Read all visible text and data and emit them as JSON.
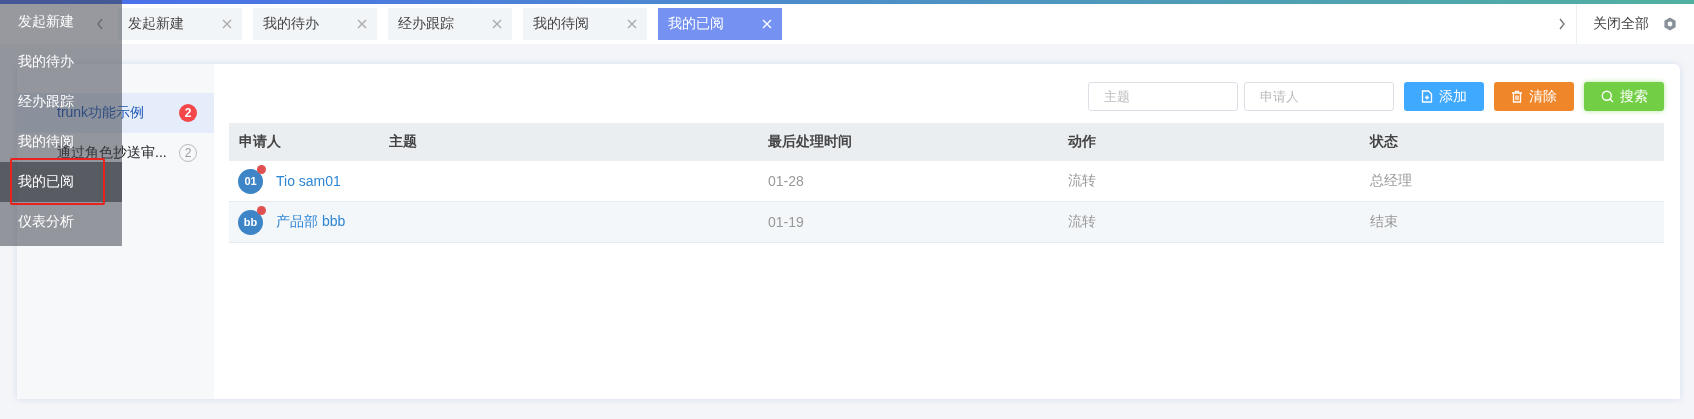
{
  "menu": {
    "items": [
      {
        "label": "发起新建",
        "selected": false
      },
      {
        "label": "我的待办",
        "selected": false
      },
      {
        "label": "经办跟踪",
        "selected": false
      },
      {
        "label": "我的待阅",
        "selected": false
      },
      {
        "label": "我的已阅",
        "selected": true
      },
      {
        "label": "仪表分析",
        "selected": false
      }
    ]
  },
  "tabs": {
    "items": [
      {
        "label": "发起新建",
        "selected": false
      },
      {
        "label": "我的待办",
        "selected": false
      },
      {
        "label": "经办跟踪",
        "selected": false
      },
      {
        "label": "我的待阅",
        "selected": false
      },
      {
        "label": "我的已阅",
        "selected": true
      }
    ],
    "close_all": "关闭全部"
  },
  "sidebar": {
    "items": [
      {
        "label": "trunk功能示例",
        "count": "2",
        "selected": true
      },
      {
        "label": "通过角色抄送审...",
        "count": "2",
        "selected": false
      }
    ]
  },
  "filters": {
    "fields": [
      {
        "placeholder": "主题"
      },
      {
        "placeholder": "申请人"
      }
    ],
    "buttons": [
      {
        "label": "添加",
        "kind": "add"
      },
      {
        "label": "清除",
        "kind": "clear"
      },
      {
        "label": "搜索",
        "kind": "search"
      }
    ]
  },
  "table": {
    "columns": [
      "申请人",
      "主题",
      "最后处理时间",
      "动作",
      "状态"
    ],
    "rows": [
      {
        "avatar": "01",
        "applicant": "Tio sam01",
        "unread": true,
        "time": "01-28",
        "action": "流转",
        "status": "总经理"
      },
      {
        "avatar": "bb",
        "applicant": "产品部 bbb",
        "unread": true,
        "time": "01-19",
        "action": "流转",
        "status": "结束"
      }
    ]
  }
}
